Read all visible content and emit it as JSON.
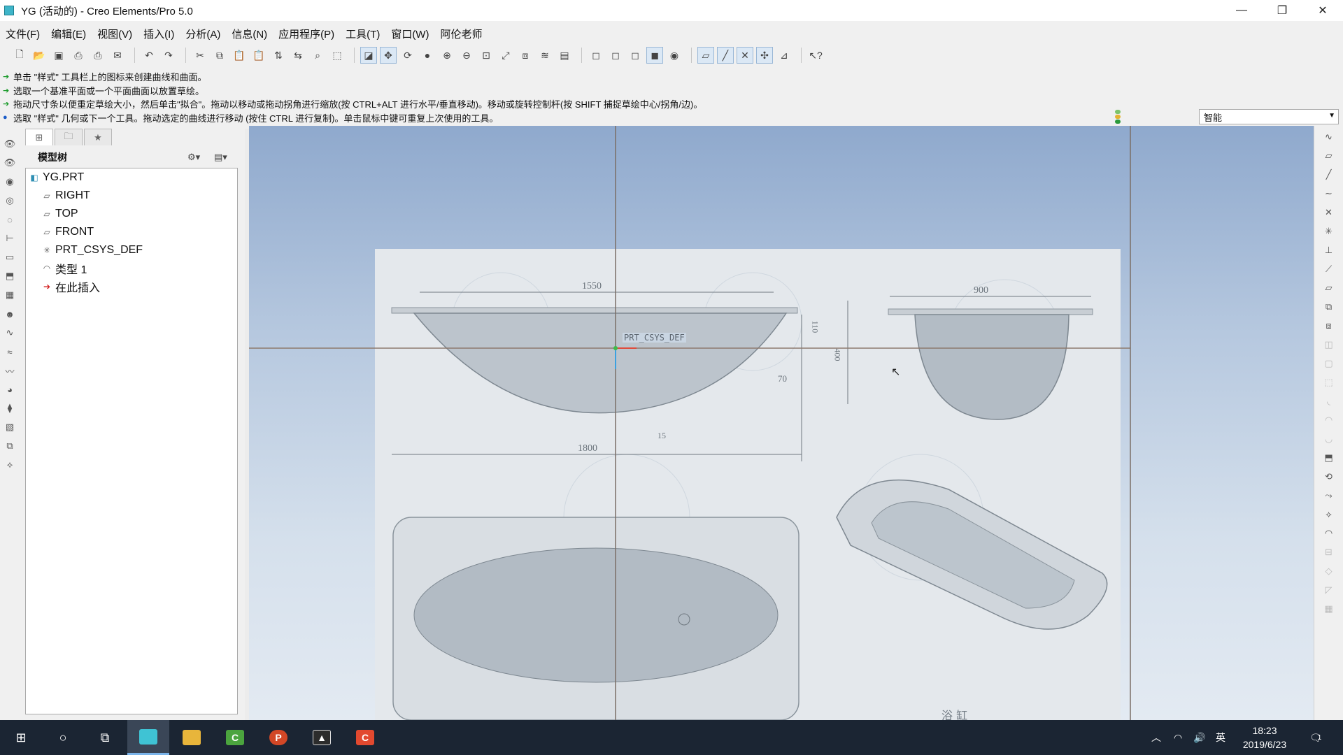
{
  "window": {
    "title": "YG (活动的) - Creo Elements/Pro 5.0",
    "minimize": "—",
    "maximize": "❐",
    "close": "✕"
  },
  "menu": [
    "文件(F)",
    "编辑(E)",
    "视图(V)",
    "插入(I)",
    "分析(A)",
    "信息(N)",
    "应用程序(P)",
    "工具(T)",
    "窗口(W)",
    "阿伦老师"
  ],
  "messages": [
    "单击 \"样式\" 工具栏上的图标来创建曲线和曲面。",
    "选取一个基准平面或一个平面曲面以放置草绘。",
    "拖动尺寸条以便重定草绘大小，然后单击\"拟合\"。拖动以移动或拖动拐角进行缩放(按 CTRL+ALT 进行水平/垂直移动)。移动或旋转控制杆(按 SHIFT 捕捉草绘中心/拐角/边)。",
    "选取 \"样式\" 几何或下一个工具。拖动选定的曲线进行移动 (按住 CTRL 进行复制)。单击鼠标中键可重复上次使用的工具。"
  ],
  "filter": {
    "value": "智能"
  },
  "model_tree": {
    "title": "模型树",
    "items": [
      {
        "label": "YG.PRT",
        "icon": "part-icon"
      },
      {
        "label": "RIGHT",
        "icon": "datum-plane-icon"
      },
      {
        "label": "TOP",
        "icon": "datum-plane-icon"
      },
      {
        "label": "FRONT",
        "icon": "datum-plane-icon"
      },
      {
        "label": "PRT_CSYS_DEF",
        "icon": "csys-icon"
      },
      {
        "label": "类型 1",
        "icon": "style-feature-icon"
      },
      {
        "label": "在此插入",
        "icon": "insert-here-icon"
      }
    ]
  },
  "graphics": {
    "csys_label": "PRT_CSYS_DEF",
    "drawing": {
      "dim_top_left": "1550",
      "dim_top_right": "900",
      "dim_bottom": "1800",
      "dim_rim": "110",
      "dim_height": "400",
      "dim_angle": "70",
      "dim_small": "15",
      "caption": "浴 缸"
    }
  },
  "taskbar": {
    "time": "18:23",
    "date": "2019/6/23",
    "ime": "英",
    "notifications": "1"
  }
}
